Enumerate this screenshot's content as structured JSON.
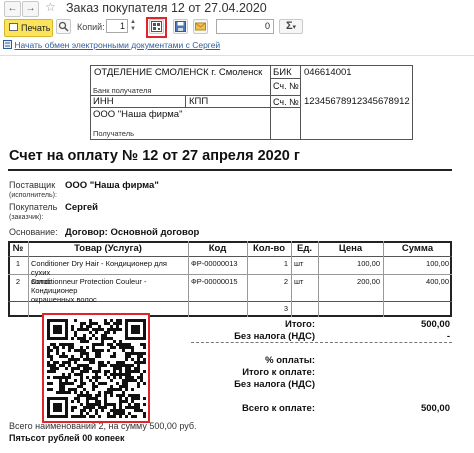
{
  "window": {
    "title": "Заказ покупателя 12 от 27.04.2020",
    "nav_back": "←",
    "nav_forward": "→",
    "star": "☆"
  },
  "toolbar": {
    "print_label": "Печать",
    "copies_label": "Копий:",
    "copies_value": "1",
    "sum_value": "0",
    "sum_symbol": "Σ",
    "sum_dropdown": "▾"
  },
  "exchange_link": "Начать обмен электронными документами с Сергей",
  "bank": {
    "bank_name": "ОТДЕЛЕНИЕ СМОЛЕНСК г. Смоленск",
    "bank_caption": "Банк получателя",
    "bik_label": "БИК",
    "bik_value": "046614001",
    "account_label_1": "Сч. №",
    "inn_label": "ИНН",
    "kpp_label": "КПП",
    "account_label_2": "Сч. №",
    "account_value": "12345678912345678912",
    "recipient_name": "ООО \"Наша фирма\"",
    "recipient_caption": "Получатель"
  },
  "invoice_title": "Счет на оплату № 12 от 27 апреля 2020 г",
  "parties": {
    "supplier_label_1": "Поставщик",
    "supplier_label_2": "(исполнитель):",
    "supplier_value": "ООО \"Наша фирма\"",
    "buyer_label_1": "Покупатель",
    "buyer_label_2": "(заказчик):",
    "buyer_value": "Сергей",
    "basis_label": "Основание:",
    "basis_value": "Договор: Основной договор"
  },
  "table": {
    "headers": [
      "№",
      "Товар (Услуга)",
      "Код",
      "Кол-во",
      "Ед.",
      "Цена",
      "Сумма"
    ],
    "rows": [
      {
        "n": "1",
        "name_1": "Conditioner Dry Hair - Кондиционер для сухих",
        "name_2": "волос",
        "code": "ФР-00000013",
        "qty": "1",
        "unit": "шт",
        "price": "100,00",
        "sum": "100,00"
      },
      {
        "n": "2",
        "name_1": "Conditionneur Protection Couleur - Кондиционер",
        "name_2": "Conditionneur Protection Couleur - Кондиционер для",
        "name_3": "окрашенных волос",
        "code": "ФР-00000015",
        "qty": "2",
        "unit": "шт",
        "price": "200,00",
        "sum": "400,00"
      }
    ],
    "total_qty": "3"
  },
  "totals": {
    "total_label": "Итого:",
    "total_value": "500,00",
    "vat_label": "Без налога (НДС)",
    "vat_value": "-",
    "pct_label": "% оплаты:",
    "to_pay_label": "Итого к оплате:",
    "vat2_label": "Без налога (НДС)",
    "grand_label": "Всего к оплате:",
    "grand_value": "500,00"
  },
  "footer": {
    "items_line": "Всего наименований 2, на сумму 500,00 руб.",
    "words_line": "Пятьсот рублей 00 копеек"
  },
  "colors": {
    "highlight": "#e3232b",
    "print_button": "#fbe45c",
    "link": "#2f5d9a"
  }
}
